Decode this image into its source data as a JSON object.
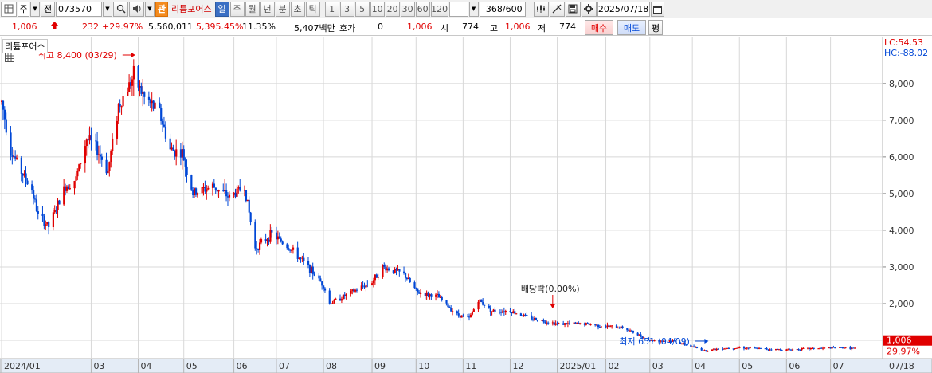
{
  "toolbar": {
    "market_type": "주",
    "prefix": "전",
    "code": "073570",
    "badge": "관",
    "stock_name": "리튬포어스",
    "periods": [
      {
        "label": "일",
        "active": true
      },
      {
        "label": "주",
        "active": false
      },
      {
        "label": "월",
        "active": false
      },
      {
        "label": "년",
        "active": false
      },
      {
        "label": "분",
        "active": false
      },
      {
        "label": "초",
        "active": false
      },
      {
        "label": "틱",
        "active": false
      }
    ],
    "minutes": [
      "1",
      "3",
      "5",
      "10",
      "20",
      "30",
      "60",
      "120"
    ],
    "count": "368",
    "count_total": "/600",
    "date": "2025/07/18",
    "colors": {
      "period_active": "#3a6fc4",
      "badge": "#f48b1e"
    }
  },
  "info": {
    "price": "1,006",
    "change": "232",
    "change_pct": "+29.97%",
    "volume": "5,560,011",
    "volume_pct": "5,395.45%",
    "turnover": "11.35%",
    "amount": "5,407백만",
    "quote_label": "호가",
    "quote_value": "0",
    "quote_price": "1,006",
    "open_label": "시",
    "open": "774",
    "high_label": "고",
    "high": "1,006",
    "low_label": "저",
    "low": "774",
    "buy_label": "매수",
    "sell_label": "매도",
    "avg_label": "평"
  },
  "chart_data": {
    "type": "candlestick",
    "legend": "리튬포어스",
    "annotations": {
      "high": "최고 8,400 (03/29)",
      "low": "최저 651 (04/09)",
      "dividend": "배당락(0.00%)",
      "lc": "LC:54.53",
      "hc": "HC:-88.02"
    },
    "current_price_label": "1,006",
    "current_change_label": "29.97%",
    "ylim": [
      500,
      8800
    ],
    "y_ticks": [
      1000,
      2000,
      3000,
      4000,
      5000,
      6000,
      7000,
      8000
    ],
    "y_tick_labels": [
      "1,000",
      "2,000",
      "3,000",
      "4,000",
      "5,000",
      "6,000",
      "7,000",
      "8,000"
    ],
    "x_labels": [
      "2024/01",
      "03",
      "04",
      "05",
      "06",
      "07",
      "08",
      "09",
      "10",
      "11",
      "12",
      "2025/01",
      "02",
      "03",
      "04",
      "05",
      "06",
      "07",
      "07/18"
    ],
    "x_label_dates": [
      "2024-01-02",
      "2024-03-01",
      "2024-04-01",
      "2024-05-01",
      "2024-06-03",
      "2024-07-01",
      "2024-08-01",
      "2024-09-02",
      "2024-10-01",
      "2024-11-01",
      "2024-12-02",
      "2025-01-02",
      "2025-02-03",
      "2025-03-04",
      "2025-04-01",
      "2025-05-02",
      "2025-06-02",
      "2025-07-01",
      "2025-07-18"
    ],
    "close_series": [
      {
        "date": "2024-01-02",
        "close": 7500
      },
      {
        "date": "2024-01-08",
        "close": 6200
      },
      {
        "date": "2024-01-15",
        "close": 5600
      },
      {
        "date": "2024-01-22",
        "close": 5100
      },
      {
        "date": "2024-01-26",
        "close": 4400
      },
      {
        "date": "2024-02-02",
        "close": 4100
      },
      {
        "date": "2024-02-13",
        "close": 5200
      },
      {
        "date": "2024-02-20",
        "close": 5400
      },
      {
        "date": "2024-02-27",
        "close": 6500
      },
      {
        "date": "2024-03-05",
        "close": 6200
      },
      {
        "date": "2024-03-12",
        "close": 5600
      },
      {
        "date": "2024-03-19",
        "close": 7400
      },
      {
        "date": "2024-03-29",
        "close": 8200
      },
      {
        "date": "2024-04-05",
        "close": 7600
      },
      {
        "date": "2024-04-15",
        "close": 7200
      },
      {
        "date": "2024-04-22",
        "close": 6200
      },
      {
        "date": "2024-04-30",
        "close": 6100
      },
      {
        "date": "2024-05-07",
        "close": 5000
      },
      {
        "date": "2024-05-20",
        "close": 5200
      },
      {
        "date": "2024-05-31",
        "close": 4900
      },
      {
        "date": "2024-06-10",
        "close": 5200
      },
      {
        "date": "2024-06-17",
        "close": 3500
      },
      {
        "date": "2024-06-28",
        "close": 3900
      },
      {
        "date": "2024-07-10",
        "close": 3500
      },
      {
        "date": "2024-07-22",
        "close": 3000
      },
      {
        "date": "2024-08-01",
        "close": 2500
      },
      {
        "date": "2024-08-05",
        "close": 2000
      },
      {
        "date": "2024-08-19",
        "close": 2300
      },
      {
        "date": "2024-09-02",
        "close": 2600
      },
      {
        "date": "2024-09-09",
        "close": 3000
      },
      {
        "date": "2024-09-23",
        "close": 2800
      },
      {
        "date": "2024-10-02",
        "close": 2300
      },
      {
        "date": "2024-10-15",
        "close": 2200
      },
      {
        "date": "2024-10-28",
        "close": 1700
      },
      {
        "date": "2024-11-05",
        "close": 1600
      },
      {
        "date": "2024-11-11",
        "close": 2100
      },
      {
        "date": "2024-11-20",
        "close": 1800
      },
      {
        "date": "2024-12-02",
        "close": 1800
      },
      {
        "date": "2024-12-16",
        "close": 1600
      },
      {
        "date": "2025-01-02",
        "close": 1450
      },
      {
        "date": "2025-01-20",
        "close": 1450
      },
      {
        "date": "2025-02-03",
        "close": 1380
      },
      {
        "date": "2025-02-14",
        "close": 1350
      },
      {
        "date": "2025-03-04",
        "close": 1000
      },
      {
        "date": "2025-03-20",
        "close": 980
      },
      {
        "date": "2025-04-01",
        "close": 820
      },
      {
        "date": "2025-04-09",
        "close": 720
      },
      {
        "date": "2025-04-21",
        "close": 780
      },
      {
        "date": "2025-05-02",
        "close": 800
      },
      {
        "date": "2025-05-20",
        "close": 760
      },
      {
        "date": "2025-06-02",
        "close": 740
      },
      {
        "date": "2025-06-16",
        "close": 770
      },
      {
        "date": "2025-07-01",
        "close": 790
      },
      {
        "date": "2025-07-10",
        "close": 800
      },
      {
        "date": "2025-07-17",
        "close": 774
      },
      {
        "date": "2025-07-18",
        "close": 1006
      }
    ],
    "colors": {
      "up": "#e00000",
      "down": "#0047d6",
      "grid": "#d8d8d8",
      "price_box": "#e00000"
    },
    "grid": true
  }
}
